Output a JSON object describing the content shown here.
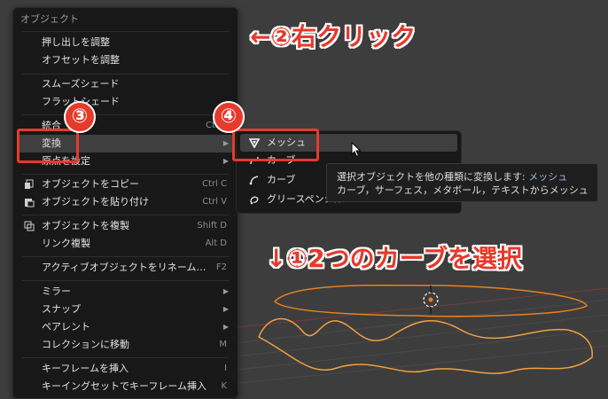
{
  "menu": {
    "title": "オブジェクト",
    "items": [
      {
        "label": "押し出しを調整"
      },
      {
        "label": "オフセットを調整"
      },
      {
        "label": "スムーズシェード"
      },
      {
        "label": "フラットシェード"
      },
      {
        "label": "統合",
        "shortcut": "Ctrl J"
      },
      {
        "label": "変換"
      },
      {
        "label": "原点を設定"
      },
      {
        "label": "オブジェクトをコピー",
        "shortcut": "Ctrl C"
      },
      {
        "label": "オブジェクトを貼り付け",
        "shortcut": "Ctrl V"
      },
      {
        "label": "オブジェクトを複製",
        "shortcut": "Shift D"
      },
      {
        "label": "リンク複製",
        "shortcut": "Alt D"
      },
      {
        "label": "アクティブオブジェクトをリネーム…",
        "shortcut": "F2"
      },
      {
        "label": "ミラー"
      },
      {
        "label": "スナップ"
      },
      {
        "label": "ペアレント"
      },
      {
        "label": "コレクションに移動",
        "shortcut": "M"
      },
      {
        "label": "キーフレームを挿入",
        "shortcut": "I"
      },
      {
        "label": "キーイングセットでキーフレーム挿入",
        "shortcut": "K"
      }
    ]
  },
  "submenu": {
    "items": [
      {
        "label": "メッシュ"
      },
      {
        "label": "カーブ"
      },
      {
        "label": "カーブ"
      },
      {
        "label": "グリースペンシル"
      }
    ]
  },
  "tooltip": {
    "line1": "選択オブジェクトを他の種類に変換します:",
    "line1_value": "メッシュ",
    "line2": "カーブ，サーフェス，メタボール，テキストからメッシュ"
  },
  "annotations": {
    "step2": "←②右クリック",
    "step1": "↓①2つのカーブを選択",
    "n3": "③",
    "n4": "④"
  },
  "colors": {
    "accent": "#e53a2c",
    "curve": "#e8821e"
  }
}
